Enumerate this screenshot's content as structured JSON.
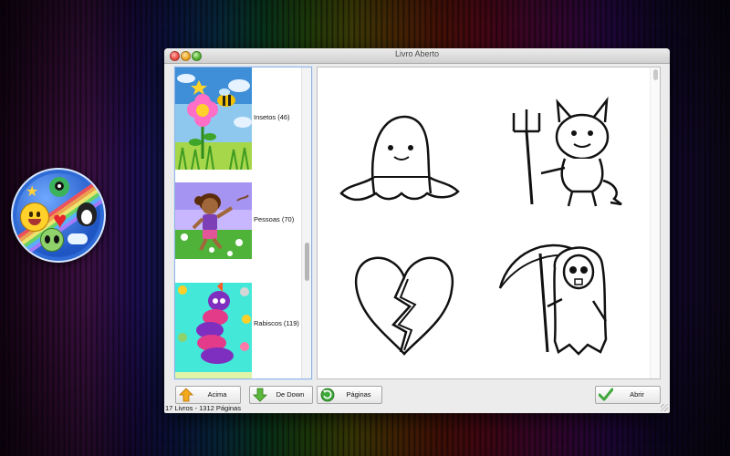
{
  "window": {
    "title": "Livro Aberto"
  },
  "books": [
    {
      "label": "Insetos (46)"
    },
    {
      "label": "Pessoas (70)"
    },
    {
      "label": "Rabiscos (119)"
    }
  ],
  "preview": {
    "drawings": [
      "ghost-drawing",
      "devil-drawing",
      "broken-heart-drawing",
      "grim-reaper-drawing"
    ]
  },
  "toolbar": {
    "up_label": "Acima",
    "down_label": "De Down",
    "pages_label": "Páginas",
    "open_label": "Abrir"
  },
  "status": {
    "text": "17 Livros - 1312 Páginas"
  },
  "colors": {
    "accent_blue": "#8fb2e0",
    "up_arrow": "#f2a91e",
    "down_arrow": "#5cb83c",
    "check": "#3fa83a"
  }
}
